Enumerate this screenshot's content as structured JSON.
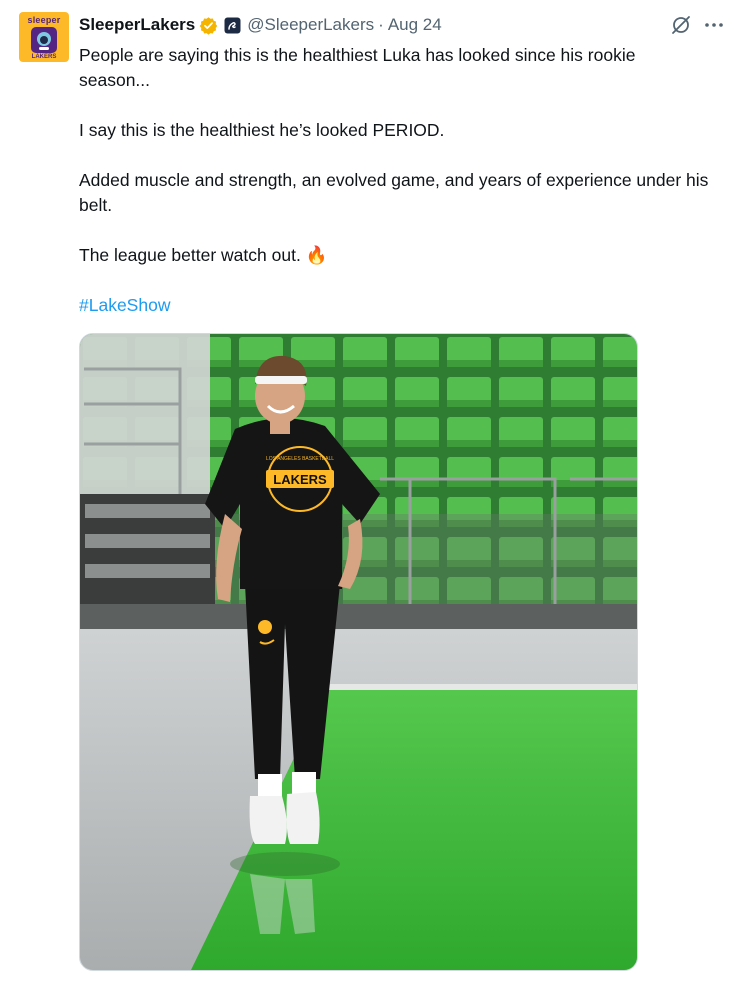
{
  "post": {
    "avatar": {
      "brand": "sleeper",
      "team": "LAKERS"
    },
    "display_name": "SleeperLakers",
    "handle": "@SleeperLakers",
    "separator": "·",
    "date": "Aug 24",
    "verified": true,
    "lines": [
      "People are saying this is the healthiest Luka has looked since his rookie season...",
      "I say this is the healthiest he’s looked PERIOD.",
      "Added muscle and strength, an evolved game, and years of experience under his belt.",
      "The league better watch out."
    ],
    "emoji": "🔥",
    "hashtag": "#LakeShow",
    "shirt_text": "LAKERS",
    "shirt_subtext": "LOS ANGELES BASKETBALL"
  },
  "colors": {
    "verified": "#f4b400",
    "link": "#1d9bf0",
    "muted": "#536471",
    "court_green": "#3dbd3a",
    "seat_green": "#4fb84c"
  },
  "icons": {
    "grok": "grok-icon",
    "more": "more-icon",
    "verified": "verified-badge-icon"
  }
}
